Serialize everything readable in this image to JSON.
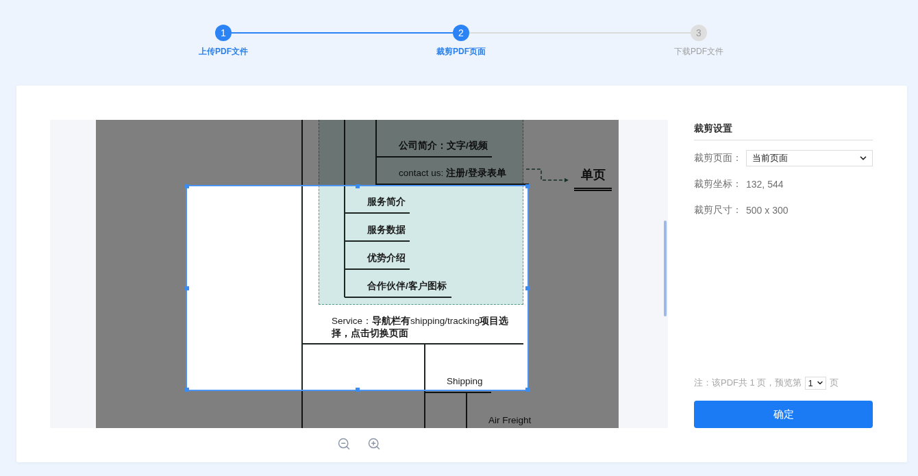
{
  "steps": [
    {
      "number": "1",
      "label": "上传PDF文件",
      "reached": true
    },
    {
      "number": "2",
      "label": "裁剪PDF页面",
      "reached": true
    },
    {
      "number": "3",
      "label": "下载PDF文件",
      "reached": false
    }
  ],
  "preview": {
    "topics": [
      {
        "kind": "topic",
        "text": "公司简介：文字/视频",
        "bold": true
      },
      {
        "kind": "topic",
        "text": "contact us: **注册/登录表单**",
        "bold": false
      },
      {
        "kind": "summary",
        "text": "单页",
        "bold": true
      },
      {
        "kind": "topic",
        "text": "服务简介",
        "bold": true
      },
      {
        "kind": "topic",
        "text": "服务数据",
        "bold": true
      },
      {
        "kind": "topic",
        "text": "优势介绍",
        "bold": true
      },
      {
        "kind": "topic",
        "text": "合作伙伴/客户图标",
        "bold": true
      },
      {
        "kind": "topic",
        "text": "Service：**导航栏有**shipping/tracking**项目选择，点击切换页面**",
        "bold": false
      },
      {
        "kind": "topic",
        "text": "Shipping",
        "bold": false
      },
      {
        "kind": "plain",
        "text": "Air Freight",
        "bold": false
      }
    ]
  },
  "settings": {
    "title": "裁剪设置",
    "fields": [
      {
        "kind": "select",
        "label": "裁剪页面：",
        "value": "当前页面"
      },
      {
        "kind": "text",
        "label": "裁剪坐标：",
        "value": "132, 544"
      },
      {
        "kind": "text",
        "label": "裁剪尺寸：",
        "value": "500 x 300"
      }
    ],
    "note": {
      "text": "注：该PDF共 1 页，预览第",
      "page": "1",
      "suffix": "页"
    },
    "confirm_button": "确定"
  }
}
